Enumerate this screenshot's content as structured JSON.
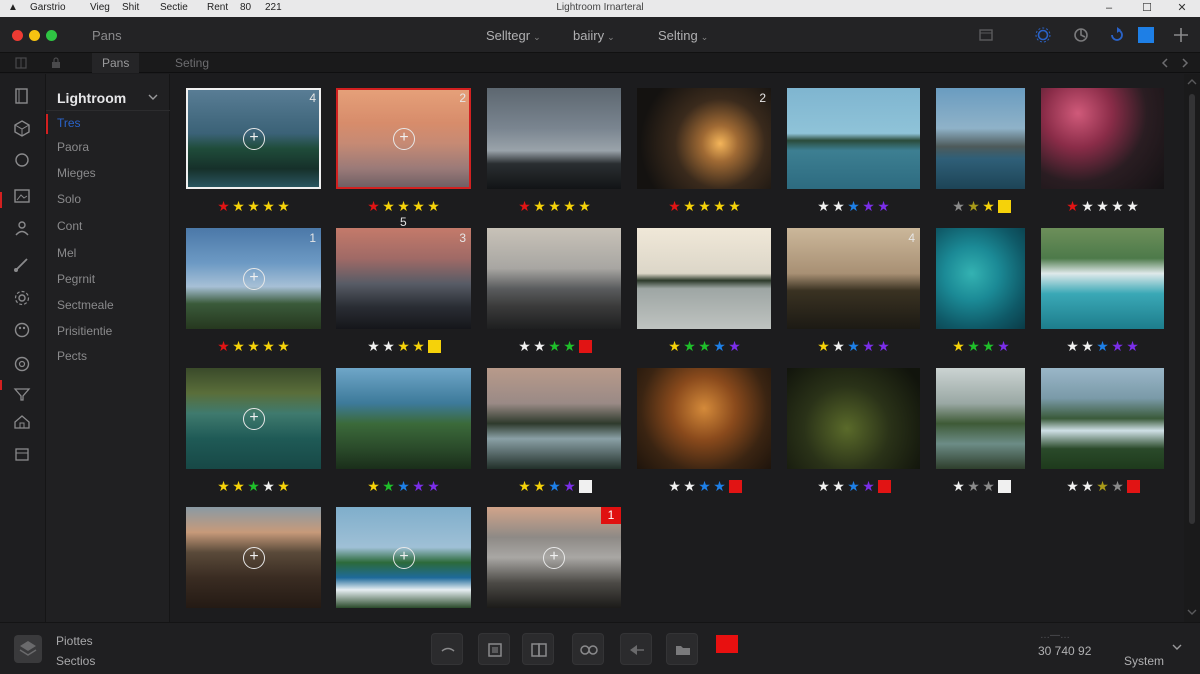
{
  "menubar": {
    "apple": "",
    "items": [
      "Garstrio",
      "Vieg",
      "Shit",
      "Sectie",
      "Rent",
      "80",
      "221"
    ],
    "window_title": "Lightroom Irnarteral",
    "controls": [
      "–",
      "☐",
      "✕"
    ]
  },
  "titlebar": {
    "title": "Pans",
    "dropdowns": [
      "Selltegr",
      "baiiry",
      "Selting"
    ]
  },
  "tabs": [
    "Pans",
    "Seting"
  ],
  "sidebar": {
    "title": "Lightroom",
    "items": [
      {
        "label": "Tres",
        "active": true
      },
      {
        "label": "Paora",
        "active": false
      },
      {
        "label": "Mieges",
        "active": false
      },
      {
        "label": "Solo",
        "active": false
      },
      {
        "label": "Cont",
        "active": false
      },
      {
        "label": "Mel",
        "active": false
      },
      {
        "label": "Pegrnit",
        "active": false
      },
      {
        "label": "Sectmeale",
        "active": false
      },
      {
        "label": "Prisitientie",
        "active": false
      },
      {
        "label": "Pects",
        "active": false
      }
    ]
  },
  "colors": {
    "red": "#e11414",
    "yellow": "#f5d20a",
    "blue": "#1e7fe6",
    "purple": "#7a2ee8",
    "green": "#1fbf2a",
    "white": "#f0f0f0",
    "gray": "#8a8a8a",
    "olive": "#a89a1a",
    "accent": "#2a63c9"
  },
  "grid": {
    "photos": [
      {
        "scene": "beach palms",
        "badge": "4",
        "plus": true,
        "selected": "white",
        "rating": [
          "red",
          "yellow",
          "yellow",
          "yellow",
          "yellow"
        ]
      },
      {
        "scene": "sunset sea",
        "badge": "2",
        "plus": true,
        "selected": "red",
        "rating": [
          "red",
          "yellow",
          "yellow",
          "yellow",
          "yellow"
        ]
      },
      {
        "scene": "stormy shore",
        "badge": "",
        "plus": false,
        "selected": "",
        "rating": [
          "red",
          "yellow",
          "yellow",
          "yellow",
          "yellow"
        ]
      },
      {
        "scene": "palm road",
        "badge": "2",
        "plus": false,
        "selected": "",
        "rating": [
          "red",
          "yellow",
          "yellow",
          "yellow",
          "yellow"
        ]
      },
      {
        "scene": "lagoon huts",
        "badge": "",
        "plus": false,
        "selected": "",
        "rating": [
          "white",
          "white",
          "blue",
          "purple",
          "purple"
        ]
      },
      {
        "scene": "mountain lake",
        "badge": "",
        "plus": false,
        "selected": "",
        "rating": [
          "gray",
          "olive",
          "yellow",
          "sq:yellow"
        ]
      },
      {
        "scene": "blossom tree",
        "badge": "",
        "plus": false,
        "selected": "",
        "rating": [
          "red",
          "white",
          "white",
          "white",
          "white"
        ]
      },
      {
        "scene": "blue coast",
        "badge": "1",
        "plus": true,
        "selected": "",
        "rating": [
          "red",
          "yellow",
          "yellow",
          "yellow",
          "yellow"
        ]
      },
      {
        "scene": "dusk figure",
        "badge": "3",
        "plus": false,
        "selected": "",
        "rating": [
          "white",
          "white",
          "yellow",
          "yellow",
          "sq:yellow"
        ]
      },
      {
        "scene": "rocky beach",
        "badge": "",
        "plus": false,
        "selected": "",
        "rating": [
          "white",
          "white",
          "green",
          "green",
          "sq:red"
        ]
      },
      {
        "scene": "palm reflection",
        "badge": "",
        "plus": false,
        "selected": "",
        "rating": [
          "yellow",
          "green",
          "green",
          "blue",
          "purple"
        ]
      },
      {
        "scene": "palm silhouettes",
        "badge": "4",
        "plus": false,
        "selected": "",
        "rating": [
          "yellow",
          "white",
          "blue",
          "purple",
          "purple"
        ]
      },
      {
        "scene": "teal water",
        "badge": "",
        "plus": false,
        "selected": "",
        "rating": [
          "yellow",
          "green",
          "green",
          "purple"
        ]
      },
      {
        "scene": "waterfall",
        "badge": "",
        "plus": false,
        "selected": "",
        "rating": [
          "white",
          "white",
          "blue",
          "purple",
          "purple"
        ]
      },
      {
        "scene": "green lagoon",
        "badge": "",
        "plus": true,
        "selected": "",
        "rating": [
          "yellow",
          "yellow",
          "green",
          "white",
          "yellow"
        ]
      },
      {
        "scene": "man in trees",
        "badge": "",
        "plus": false,
        "selected": "",
        "rating": [
          "yellow",
          "green",
          "blue",
          "purple",
          "purple"
        ]
      },
      {
        "scene": "bay cliffs",
        "badge": "",
        "plus": false,
        "selected": "",
        "rating": [
          "yellow",
          "yellow",
          "blue",
          "purple",
          "sq:white"
        ]
      },
      {
        "scene": "autumn tree",
        "badge": "",
        "plus": false,
        "selected": "",
        "rating": [
          "white",
          "white",
          "blue",
          "blue",
          "sq:red"
        ]
      },
      {
        "scene": "night forest",
        "badge": "",
        "plus": false,
        "selected": "",
        "rating": [
          "white",
          "white",
          "blue",
          "purple",
          "sq:red"
        ]
      },
      {
        "scene": "river",
        "badge": "",
        "plus": false,
        "selected": "",
        "rating": [
          "white",
          "gray",
          "gray",
          "sq:white"
        ]
      },
      {
        "scene": "falls valley",
        "badge": "",
        "plus": false,
        "selected": "",
        "rating": [
          "white",
          "white",
          "olive",
          "gray",
          "sq:red"
        ]
      },
      {
        "scene": "dusk hills",
        "badge": "",
        "plus": true,
        "selected": "",
        "rating": []
      },
      {
        "scene": "palm surf",
        "badge": "",
        "plus": true,
        "selected": "",
        "rating": []
      },
      {
        "scene": "misty hiker",
        "badge": "1",
        "badge_style": "red",
        "plus": true,
        "selected": "",
        "rating": []
      }
    ],
    "stray_label": "5"
  },
  "bottombar": {
    "label_top": "Piottes",
    "label_bottom": "Sectios",
    "zoom_values": "30   740    92",
    "faint_text": "…—…",
    "system_label": "System"
  }
}
